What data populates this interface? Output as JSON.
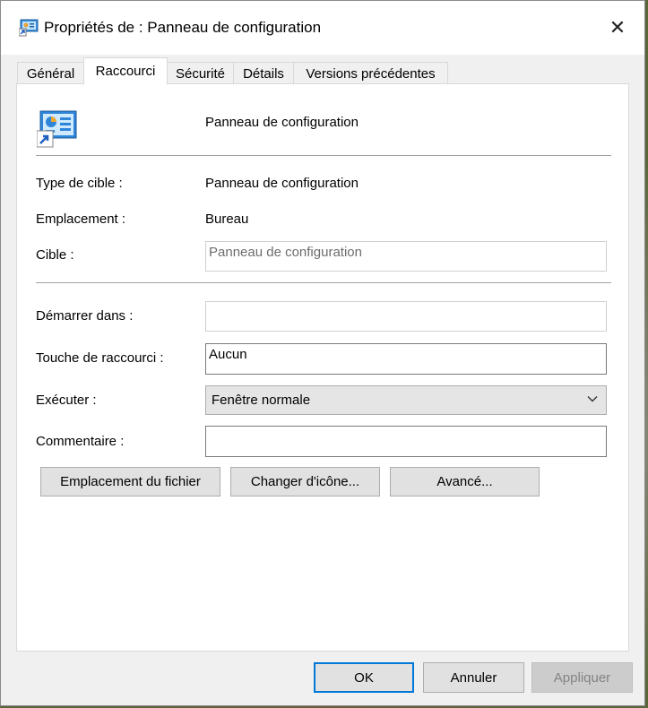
{
  "window": {
    "title": "Propriétés de : Panneau de configuration",
    "close_glyph": "✕"
  },
  "tabs": [
    {
      "label": "Général",
      "active": false
    },
    {
      "label": "Raccourci",
      "active": true
    },
    {
      "label": "Sécurité",
      "active": false
    },
    {
      "label": "Détails",
      "active": false
    },
    {
      "label": "Versions précédentes",
      "active": false
    }
  ],
  "shortcut": {
    "name": "Panneau de configuration",
    "icon": "control-panel-shortcut-icon",
    "target_type_label": "Type de cible :",
    "target_type_value": "Panneau de configuration",
    "location_label": "Emplacement :",
    "location_value": "Bureau",
    "target_label": "Cible :",
    "target_value": "Panneau de configuration",
    "start_in_label": "Démarrer dans :",
    "start_in_value": "",
    "hotkey_label": "Touche de raccourci :",
    "hotkey_value": "Aucun",
    "run_label": "Exécuter :",
    "run_value": "Fenêtre normale",
    "comment_label": "Commentaire :",
    "comment_value": ""
  },
  "actions": {
    "open_location": "Emplacement du fichier",
    "change_icon": "Changer d'icône...",
    "advanced": "Avancé..."
  },
  "footer": {
    "ok": "OK",
    "cancel": "Annuler",
    "apply": "Appliquer",
    "apply_disabled": true
  },
  "colors": {
    "accent": "#0078d7",
    "panel_bg": "#ffffff",
    "dialog_bg": "#f0f0f0"
  }
}
